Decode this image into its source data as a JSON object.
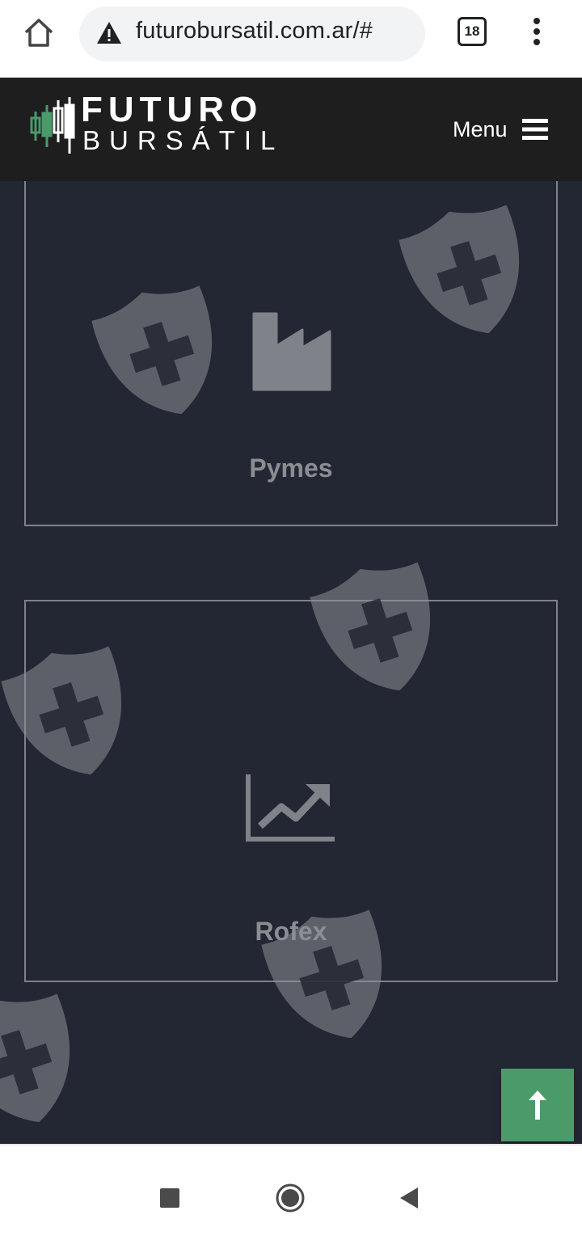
{
  "browser": {
    "url": "futurobursatil.com.ar/#",
    "tab_count": "18"
  },
  "header": {
    "logo_line1": "FUTURO",
    "logo_line2": "BURSÁTIL",
    "menu_label": "Menu"
  },
  "cards": [
    {
      "label": "Pymes",
      "icon": "factory-icon"
    },
    {
      "label": "Rofex",
      "icon": "chart-line-icon"
    }
  ],
  "colors": {
    "header_bg": "#1e1e1e",
    "content_bg": "#232733",
    "accent_green": "#4a9a6a",
    "card_border": "#7e818a"
  },
  "icons": {
    "home": "home-icon",
    "warning": "warning-icon",
    "menu": "hamburger-icon",
    "scroll_top": "arrow-up-icon",
    "watermark": "shield-plus-icon"
  }
}
